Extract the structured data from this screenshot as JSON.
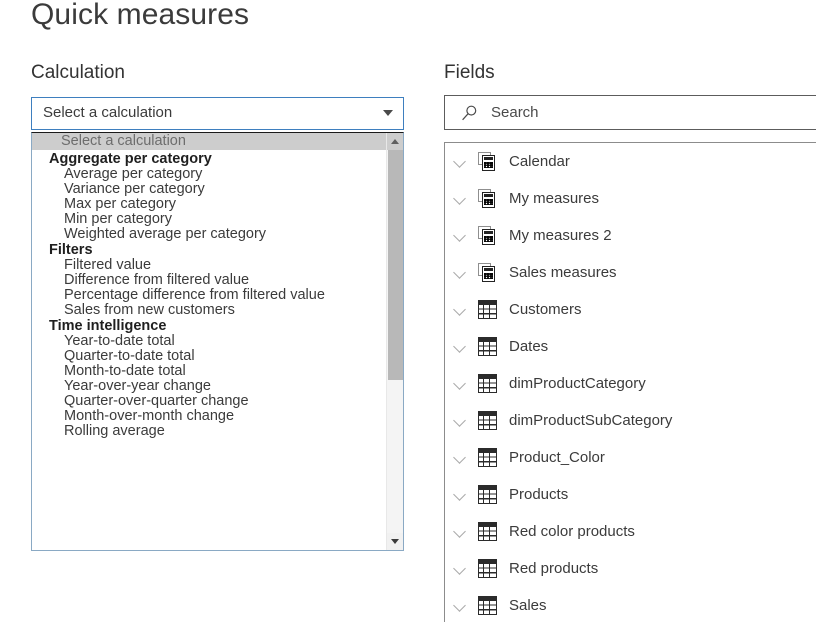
{
  "page": {
    "title": "Quick measures"
  },
  "calculation": {
    "label": "Calculation",
    "selected_value": "Select a calculation",
    "dropdown_arrow_icon": "chevron-down-icon",
    "options": [
      {
        "label": "Select a calculation",
        "type": "placeholder"
      },
      {
        "label": "Aggregate per category",
        "type": "group"
      },
      {
        "label": "Average per category",
        "type": "item"
      },
      {
        "label": "Variance per category",
        "type": "item"
      },
      {
        "label": "Max per category",
        "type": "item"
      },
      {
        "label": "Min per category",
        "type": "item"
      },
      {
        "label": "Weighted average per category",
        "type": "item"
      },
      {
        "label": "Filters",
        "type": "group"
      },
      {
        "label": "Filtered value",
        "type": "item"
      },
      {
        "label": "Difference from filtered value",
        "type": "item"
      },
      {
        "label": "Percentage difference from filtered value",
        "type": "item"
      },
      {
        "label": "Sales from new customers",
        "type": "item"
      },
      {
        "label": "Time intelligence",
        "type": "group"
      },
      {
        "label": "Year-to-date total",
        "type": "item"
      },
      {
        "label": "Quarter-to-date total",
        "type": "item"
      },
      {
        "label": "Month-to-date total",
        "type": "item"
      },
      {
        "label": "Year-over-year change",
        "type": "item"
      },
      {
        "label": "Quarter-over-quarter change",
        "type": "item"
      },
      {
        "label": "Month-over-month change",
        "type": "item"
      },
      {
        "label": "Rolling average",
        "type": "item"
      }
    ],
    "scrollbar": {
      "up_arrow_icon": "caret-up-icon",
      "down_arrow_icon": "caret-down-icon"
    }
  },
  "fields": {
    "label": "Fields",
    "search": {
      "placeholder": "Search",
      "value": "",
      "icon": "search-icon"
    },
    "items": [
      {
        "label": "Calendar",
        "icon": "calculator-icon",
        "expander": "chevron-down-icon"
      },
      {
        "label": "My measures",
        "icon": "calculator-icon",
        "expander": "chevron-down-icon"
      },
      {
        "label": "My measures 2",
        "icon": "calculator-icon",
        "expander": "chevron-down-icon"
      },
      {
        "label": "Sales measures",
        "icon": "calculator-icon",
        "expander": "chevron-down-icon"
      },
      {
        "label": "Customers",
        "icon": "table-icon",
        "expander": "chevron-down-icon"
      },
      {
        "label": "Dates",
        "icon": "table-icon",
        "expander": "chevron-down-icon"
      },
      {
        "label": "dimProductCategory",
        "icon": "table-icon",
        "expander": "chevron-down-icon"
      },
      {
        "label": "dimProductSubCategory",
        "icon": "table-icon",
        "expander": "chevron-down-icon"
      },
      {
        "label": "Product_Color",
        "icon": "table-icon",
        "expander": "chevron-down-icon"
      },
      {
        "label": "Products",
        "icon": "table-icon",
        "expander": "chevron-down-icon"
      },
      {
        "label": "Red color products",
        "icon": "table-icon",
        "expander": "chevron-down-icon"
      },
      {
        "label": "Red products",
        "icon": "table-icon",
        "expander": "chevron-down-icon"
      },
      {
        "label": "Sales",
        "icon": "table-icon",
        "expander": "chevron-down-icon"
      }
    ]
  },
  "colors": {
    "accent_border": "#3e7fbf",
    "dropdown_border": "#8aa9c4",
    "selected_row_bg": "#cdcdcd",
    "text": "#3b3b3b",
    "title": "#3b3b3b"
  }
}
